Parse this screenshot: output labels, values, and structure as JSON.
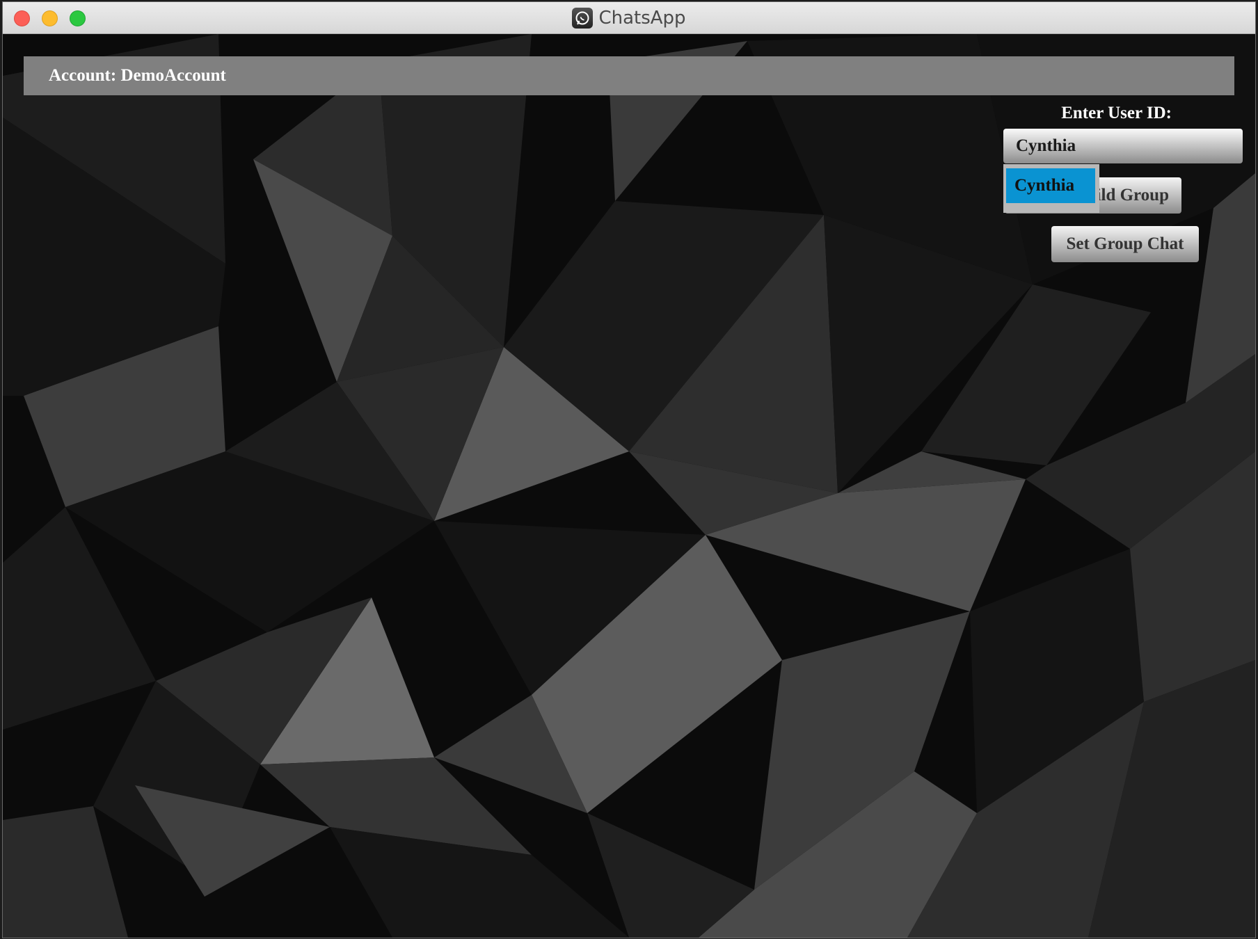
{
  "window": {
    "title": "ChatsApp"
  },
  "account": {
    "label": "Account:",
    "name": "DemoAccount"
  },
  "user_id": {
    "label": "Enter User ID:",
    "selected": "Cynthia",
    "options": [
      "Cynthia"
    ]
  },
  "buttons": {
    "build_group": "Build Group",
    "set_group_chat": "Set Group Chat"
  },
  "colors": {
    "account_bar": "#808080",
    "dropdown_highlight": "#0a93d2",
    "close": "#fc5f57",
    "minimize": "#fdbc2e",
    "zoom": "#2bc840"
  },
  "icons": {
    "app": "chat-bubble-icon"
  }
}
